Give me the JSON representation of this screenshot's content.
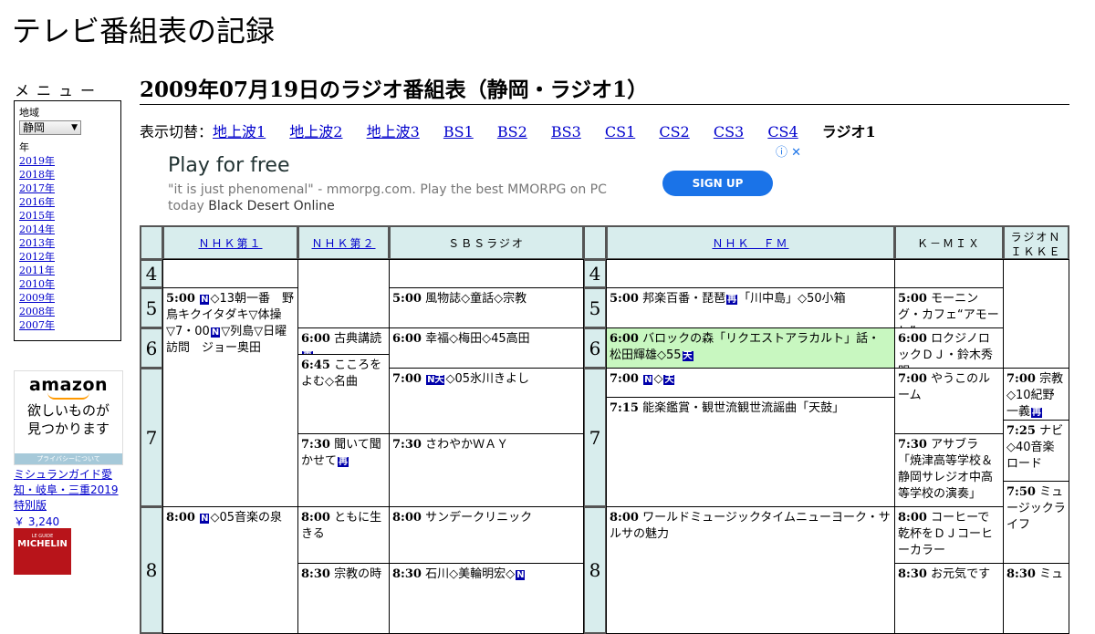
{
  "site_title": "テレビ番組表の記録",
  "sidebar": {
    "menu_heading": "メニュー",
    "region_label": "地域",
    "region_selected": "静岡",
    "year_label": "年",
    "years": [
      "2019年",
      "2018年",
      "2017年",
      "2016年",
      "2015年",
      "2014年",
      "2013年",
      "2012年",
      "2011年",
      "2010年",
      "2009年",
      "2008年",
      "2007年"
    ]
  },
  "ad_amazon": {
    "logo": "amazon",
    "tagline_1": "欲しいものが",
    "tagline_2": "見つかります",
    "privacy": "プライバシーについて"
  },
  "book": {
    "title": "ミシュランガイド愛知・岐阜・三重2019特別版",
    "price": "￥ 3,240",
    "cover_small": "LE GUIDE",
    "cover_brand": "MICHELIN"
  },
  "page_title": "2009年07月19日のラジオ番組表（静岡・ラジオ1）",
  "switcher": {
    "label": "表示切替：",
    "links": [
      "地上波1",
      "地上波2",
      "地上波3",
      "BS1",
      "BS2",
      "BS3",
      "CS1",
      "CS2",
      "CS3",
      "CS4"
    ],
    "current": "ラジオ1"
  },
  "ad_banner": {
    "headline": "Play for free",
    "desc": "\"it is just phenomenal\" - mmorpg.com. Play the best MMORPG on PC today",
    "desc_brand": "Black Desert Online",
    "cta": "SIGN UP",
    "controls": "ⓘ ✕"
  },
  "grid": {
    "channels": [
      "ＮＨＫ第１",
      "ＮＨＫ第２",
      "ＳＢＳラジオ",
      "ＮＨＫ　ＦＭ",
      "Ｋ－ＭＩＸ",
      "ラジオＮＩＫＫＥＩ"
    ],
    "hours": [
      "4",
      "5",
      "6",
      "7",
      "8"
    ],
    "programs": {
      "nhk1_0500_time": "5:00",
      "nhk1_0500_text": "◇13朝一番　野鳥キクイタダキ▽体操▽7・00",
      "nhk1_0500_text2": "▽列島▽日曜訪問　ジョー奥田",
      "nhk1_0800_time": "8:00",
      "nhk1_0800_text": "◇05音楽の泉",
      "nhk2_0600_time": "6:00",
      "nhk2_0600_text": "古典講読",
      "nhk2_0645_time": "6:45",
      "nhk2_0645_text": "こころをよむ◇名曲",
      "nhk2_0730_time": "7:30",
      "nhk2_0730_text": "聞いて聞かせて",
      "nhk2_0800_time": "8:00",
      "nhk2_0800_text": "ともに生きる",
      "nhk2_0830_time": "8:30",
      "nhk2_0830_text": "宗教の時",
      "sbs_0500_time": "5:00",
      "sbs_0500_text": "風物誌◇童話◇宗教",
      "sbs_0600_time": "6:00",
      "sbs_0600_text": "幸福◇梅田◇45高田",
      "sbs_0700_time": "7:00",
      "sbs_0700_text": "◇05氷川きよし",
      "sbs_0730_time": "7:30",
      "sbs_0730_text": "さわやかＷＡＹ",
      "sbs_0800_time": "8:00",
      "sbs_0800_text": "サンデークリニック",
      "sbs_0830_time": "8:30",
      "sbs_0830_text": "石川◇美輪明宏◇",
      "fm_0500_time": "5:00",
      "fm_0500_text": "邦楽百番・琵琶",
      "fm_0500_text2": "「川中島」◇50小箱",
      "fm_0600_time": "6:00",
      "fm_0600_text": "バロックの森「リクエストアラカルト」話・松田輝雄◇55",
      "fm_0700_time": "7:00",
      "fm_0700_text": "◇",
      "fm_0715_time": "7:15",
      "fm_0715_text": "能楽鑑賞・観世流観世流謡曲「天鼓」",
      "fm_0800_time": "8:00",
      "fm_0800_text": "ワールドミュージックタイムニューヨーク・サルサの魅力",
      "kmix_0500_time": "5:00",
      "kmix_0500_text": "モーニング・カフェ“アモーレ”",
      "kmix_0600_time": "6:00",
      "kmix_0600_text": "ロクジノロックＤＪ・鈴木秀明",
      "kmix_0700_time": "7:00",
      "kmix_0700_text": "やうこのルーム",
      "kmix_0730_time": "7:30",
      "kmix_0730_text": "アサブラ「焼津高等学校＆静岡サレジオ中高等学校の演奏」",
      "kmix_0800_time": "8:00",
      "kmix_0800_text": "コーヒーで乾杯をＤＪコーヒーカラー",
      "kmix_0830_time": "8:30",
      "kmix_0830_text": "お元気です",
      "nikkei_0700_time": "7:00",
      "nikkei_0700_text": "宗教◇10紀野一義",
      "nikkei_0725_time": "7:25",
      "nikkei_0725_text": "ナビ◇40音楽ロード",
      "nikkei_0750_time": "7:50",
      "nikkei_0750_text": "ミュージックライフ",
      "nikkei_0830_time": "8:30",
      "nikkei_0830_text": "ミュ"
    },
    "badges": {
      "n": "N",
      "n_ten": "N天",
      "ten": "天",
      "sai": "再"
    }
  }
}
